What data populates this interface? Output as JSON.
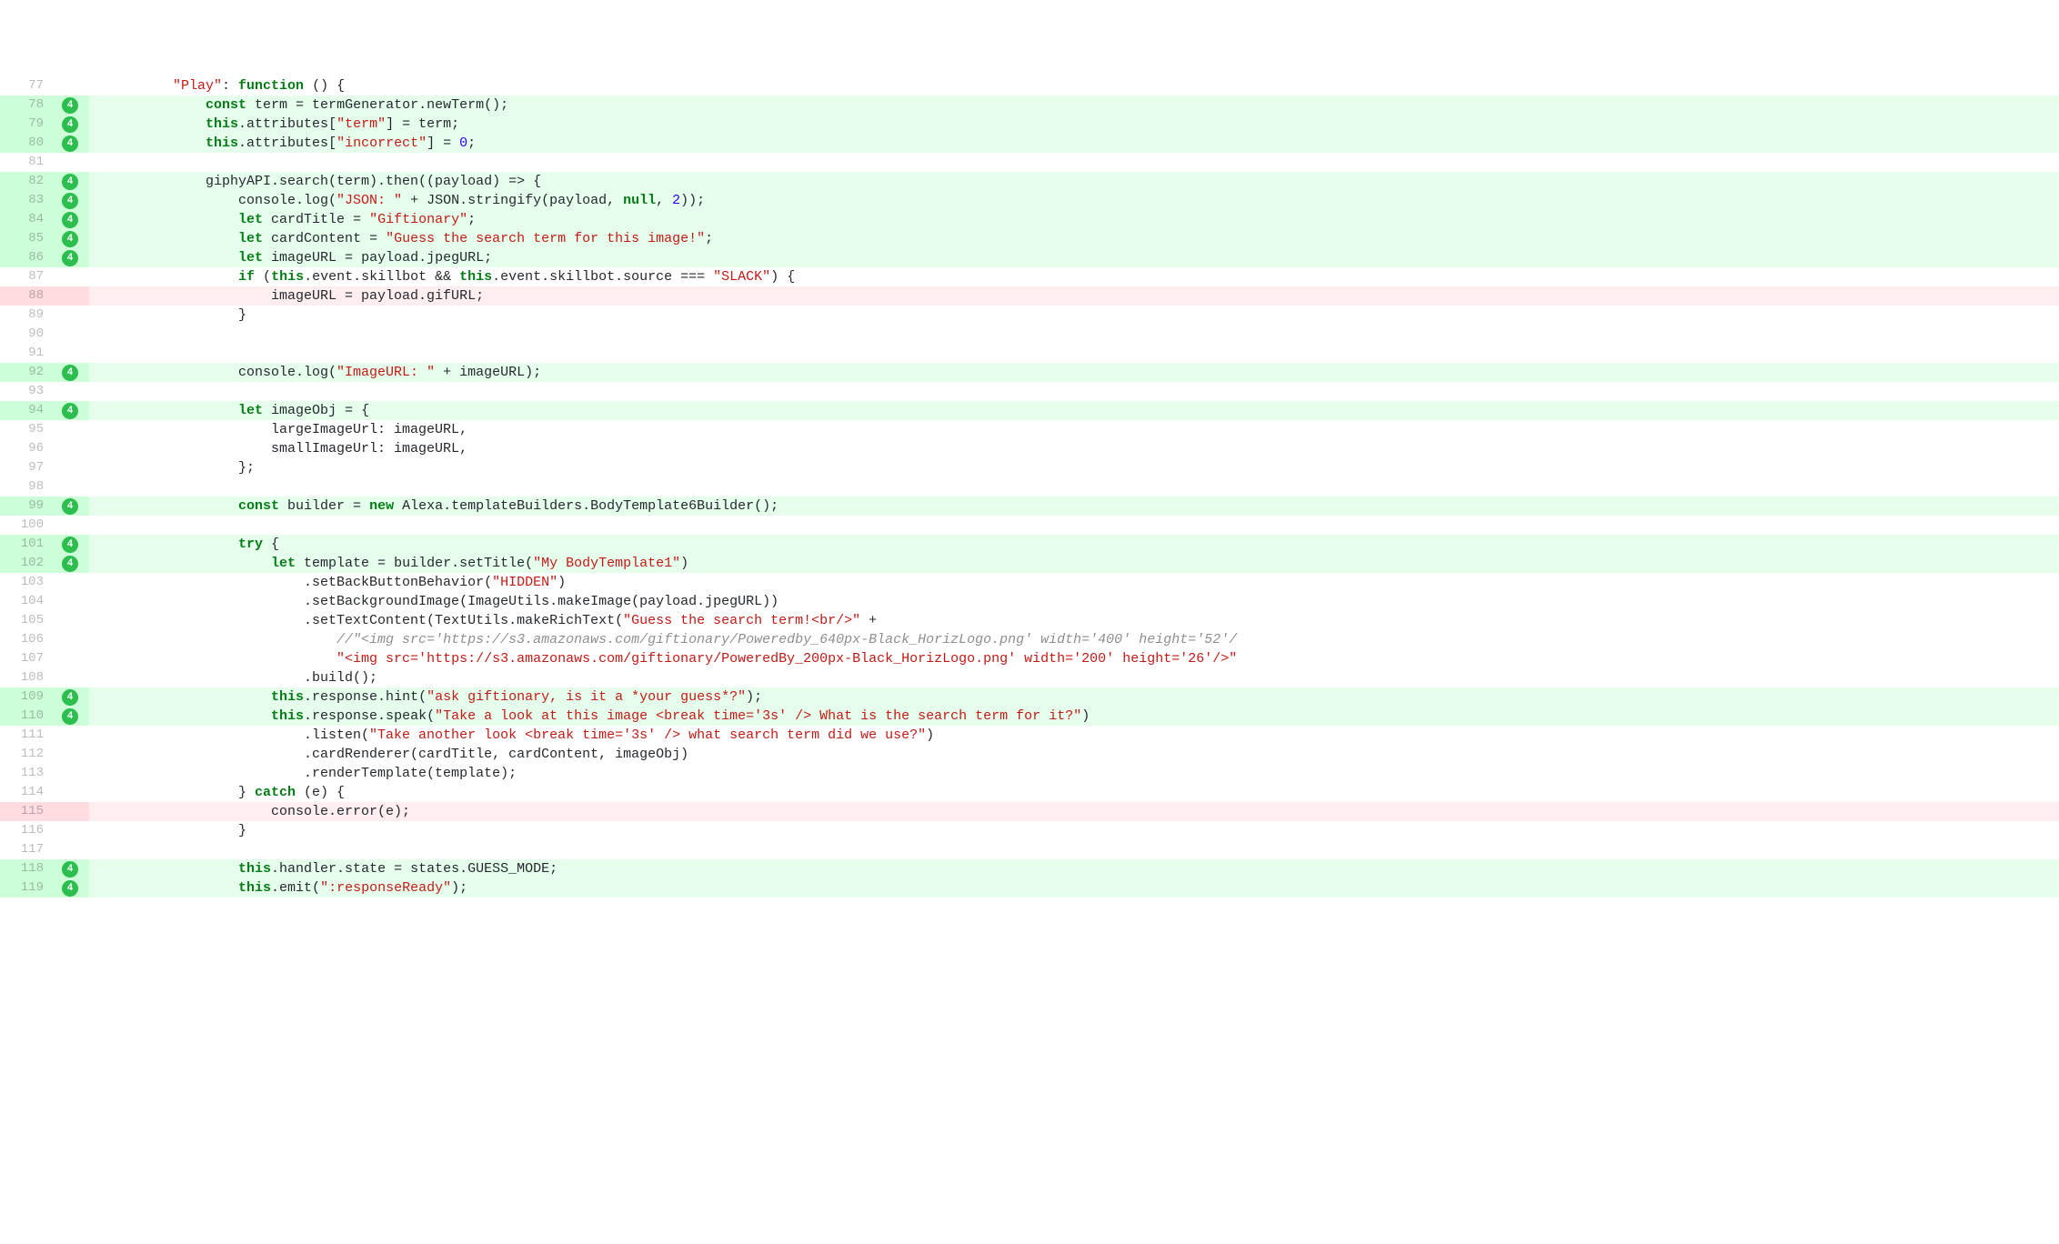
{
  "badge_label": "4",
  "lines": [
    {
      "num": 77,
      "kind": "ctx",
      "badge": false,
      "tokens": [
        {
          "c": "p",
          "t": "        "
        },
        {
          "c": "s",
          "t": "\"Play\""
        },
        {
          "c": "p",
          "t": ": "
        },
        {
          "c": "k",
          "t": "function"
        },
        {
          "c": "p",
          "t": " () {"
        }
      ]
    },
    {
      "num": 78,
      "kind": "add",
      "badge": true,
      "tokens": [
        {
          "c": "p",
          "t": "            "
        },
        {
          "c": "k",
          "t": "const"
        },
        {
          "c": "p",
          "t": " term = termGenerator.newTerm();"
        }
      ]
    },
    {
      "num": 79,
      "kind": "add",
      "badge": true,
      "tokens": [
        {
          "c": "p",
          "t": "            "
        },
        {
          "c": "kb",
          "t": "this"
        },
        {
          "c": "p",
          "t": ".attributes["
        },
        {
          "c": "s",
          "t": "\"term\""
        },
        {
          "c": "p",
          "t": "] = term;"
        }
      ]
    },
    {
      "num": 80,
      "kind": "add",
      "badge": true,
      "tokens": [
        {
          "c": "p",
          "t": "            "
        },
        {
          "c": "kb",
          "t": "this"
        },
        {
          "c": "p",
          "t": ".attributes["
        },
        {
          "c": "s",
          "t": "\"incorrect\""
        },
        {
          "c": "p",
          "t": "] = "
        },
        {
          "c": "n",
          "t": "0"
        },
        {
          "c": "p",
          "t": ";"
        }
      ]
    },
    {
      "num": 81,
      "kind": "ctx",
      "badge": false,
      "tokens": []
    },
    {
      "num": 82,
      "kind": "add",
      "badge": true,
      "tokens": [
        {
          "c": "p",
          "t": "            giphyAPI.search(term).then((payload) => {"
        }
      ]
    },
    {
      "num": 83,
      "kind": "add",
      "badge": true,
      "tokens": [
        {
          "c": "p",
          "t": "                console.log("
        },
        {
          "c": "s",
          "t": "\"JSON: \""
        },
        {
          "c": "p",
          "t": " + JSON.stringify(payload, "
        },
        {
          "c": "kb",
          "t": "null"
        },
        {
          "c": "p",
          "t": ", "
        },
        {
          "c": "n",
          "t": "2"
        },
        {
          "c": "p",
          "t": "));"
        }
      ]
    },
    {
      "num": 84,
      "kind": "add",
      "badge": true,
      "tokens": [
        {
          "c": "p",
          "t": "                "
        },
        {
          "c": "k",
          "t": "let"
        },
        {
          "c": "p",
          "t": " cardTitle = "
        },
        {
          "c": "s",
          "t": "\"Giftionary\""
        },
        {
          "c": "p",
          "t": ";"
        }
      ]
    },
    {
      "num": 85,
      "kind": "add",
      "badge": true,
      "tokens": [
        {
          "c": "p",
          "t": "                "
        },
        {
          "c": "k",
          "t": "let"
        },
        {
          "c": "p",
          "t": " cardContent = "
        },
        {
          "c": "s",
          "t": "\"Guess the search term for this image!\""
        },
        {
          "c": "p",
          "t": ";"
        }
      ]
    },
    {
      "num": 86,
      "kind": "add",
      "badge": true,
      "tokens": [
        {
          "c": "p",
          "t": "                "
        },
        {
          "c": "k",
          "t": "let"
        },
        {
          "c": "p",
          "t": " imageURL = payload.jpegURL;"
        }
      ]
    },
    {
      "num": 87,
      "kind": "ctx",
      "badge": false,
      "tokens": [
        {
          "c": "p",
          "t": "                "
        },
        {
          "c": "k",
          "t": "if"
        },
        {
          "c": "p",
          "t": " ("
        },
        {
          "c": "kb",
          "t": "this"
        },
        {
          "c": "p",
          "t": ".event.skillbot && "
        },
        {
          "c": "kb",
          "t": "this"
        },
        {
          "c": "p",
          "t": ".event.skillbot.source === "
        },
        {
          "c": "s",
          "t": "\"SLACK\""
        },
        {
          "c": "p",
          "t": ") {"
        }
      ]
    },
    {
      "num": 88,
      "kind": "del",
      "badge": false,
      "tokens": [
        {
          "c": "p",
          "t": "                    imageURL = payload.gifURL;"
        }
      ]
    },
    {
      "num": 89,
      "kind": "ctx",
      "badge": false,
      "tokens": [
        {
          "c": "p",
          "t": "                }"
        }
      ]
    },
    {
      "num": 90,
      "kind": "ctx",
      "badge": false,
      "tokens": []
    },
    {
      "num": 91,
      "kind": "ctx",
      "badge": false,
      "tokens": []
    },
    {
      "num": 92,
      "kind": "add",
      "badge": true,
      "tokens": [
        {
          "c": "p",
          "t": "                console.log("
        },
        {
          "c": "s",
          "t": "\"ImageURL: \""
        },
        {
          "c": "p",
          "t": " + imageURL);"
        }
      ]
    },
    {
      "num": 93,
      "kind": "ctx",
      "badge": false,
      "tokens": []
    },
    {
      "num": 94,
      "kind": "add",
      "badge": true,
      "tokens": [
        {
          "c": "p",
          "t": "                "
        },
        {
          "c": "k",
          "t": "let"
        },
        {
          "c": "p",
          "t": " imageObj = {"
        }
      ]
    },
    {
      "num": 95,
      "kind": "ctx",
      "badge": false,
      "tokens": [
        {
          "c": "p",
          "t": "                    largeImageUrl: imageURL,"
        }
      ]
    },
    {
      "num": 96,
      "kind": "ctx",
      "badge": false,
      "tokens": [
        {
          "c": "p",
          "t": "                    smallImageUrl: imageURL,"
        }
      ]
    },
    {
      "num": 97,
      "kind": "ctx",
      "badge": false,
      "tokens": [
        {
          "c": "p",
          "t": "                };"
        }
      ]
    },
    {
      "num": 98,
      "kind": "ctx",
      "badge": false,
      "tokens": []
    },
    {
      "num": 99,
      "kind": "add",
      "badge": true,
      "tokens": [
        {
          "c": "p",
          "t": "                "
        },
        {
          "c": "k",
          "t": "const"
        },
        {
          "c": "p",
          "t": " builder = "
        },
        {
          "c": "k",
          "t": "new"
        },
        {
          "c": "p",
          "t": " Alexa.templateBuilders.BodyTemplate6Builder();"
        }
      ]
    },
    {
      "num": 100,
      "kind": "ctx",
      "badge": false,
      "tokens": []
    },
    {
      "num": 101,
      "kind": "add",
      "badge": true,
      "tokens": [
        {
          "c": "p",
          "t": "                "
        },
        {
          "c": "k",
          "t": "try"
        },
        {
          "c": "p",
          "t": " {"
        }
      ]
    },
    {
      "num": 102,
      "kind": "add",
      "badge": true,
      "tokens": [
        {
          "c": "p",
          "t": "                    "
        },
        {
          "c": "k",
          "t": "let"
        },
        {
          "c": "p",
          "t": " template = builder.setTitle("
        },
        {
          "c": "s",
          "t": "\"My BodyTemplate1\""
        },
        {
          "c": "p",
          "t": ")"
        }
      ]
    },
    {
      "num": 103,
      "kind": "ctx",
      "badge": false,
      "tokens": [
        {
          "c": "p",
          "t": "                        .setBackButtonBehavior("
        },
        {
          "c": "s",
          "t": "\"HIDDEN\""
        },
        {
          "c": "p",
          "t": ")"
        }
      ]
    },
    {
      "num": 104,
      "kind": "ctx",
      "badge": false,
      "tokens": [
        {
          "c": "p",
          "t": "                        .setBackgroundImage(ImageUtils.makeImage(payload.jpegURL))"
        }
      ]
    },
    {
      "num": 105,
      "kind": "ctx",
      "badge": false,
      "tokens": [
        {
          "c": "p",
          "t": "                        .setTextContent(TextUtils.makeRichText("
        },
        {
          "c": "s",
          "t": "\"Guess the search term!<br/>\""
        },
        {
          "c": "p",
          "t": " +"
        }
      ]
    },
    {
      "num": 106,
      "kind": "ctx",
      "badge": false,
      "tokens": [
        {
          "c": "p",
          "t": "                            "
        },
        {
          "c": "cm",
          "t": "//\"<img src='https://s3.amazonaws.com/giftionary/Poweredby_640px-Black_HorizLogo.png' width='400' height='52'/"
        }
      ]
    },
    {
      "num": 107,
      "kind": "ctx",
      "badge": false,
      "tokens": [
        {
          "c": "p",
          "t": "                            "
        },
        {
          "c": "s",
          "t": "\"<img src='https://s3.amazonaws.com/giftionary/PoweredBy_200px-Black_HorizLogo.png' width='200' height='26'/>\""
        }
      ]
    },
    {
      "num": 108,
      "kind": "ctx",
      "badge": false,
      "tokens": [
        {
          "c": "p",
          "t": "                        .build();"
        }
      ]
    },
    {
      "num": 109,
      "kind": "add",
      "badge": true,
      "tokens": [
        {
          "c": "p",
          "t": "                    "
        },
        {
          "c": "kb",
          "t": "this"
        },
        {
          "c": "p",
          "t": ".response.hint("
        },
        {
          "c": "s",
          "t": "\"ask giftionary, is it a *your guess*?\""
        },
        {
          "c": "p",
          "t": ");"
        }
      ]
    },
    {
      "num": 110,
      "kind": "add",
      "badge": true,
      "tokens": [
        {
          "c": "p",
          "t": "                    "
        },
        {
          "c": "kb",
          "t": "this"
        },
        {
          "c": "p",
          "t": ".response.speak("
        },
        {
          "c": "s",
          "t": "\"Take a look at this image <break time='3s' /> What is the search term for it?\""
        },
        {
          "c": "p",
          "t": ")"
        }
      ]
    },
    {
      "num": 111,
      "kind": "ctx",
      "badge": false,
      "tokens": [
        {
          "c": "p",
          "t": "                        .listen("
        },
        {
          "c": "s",
          "t": "\"Take another look <break time='3s' /> what search term did we use?\""
        },
        {
          "c": "p",
          "t": ")"
        }
      ]
    },
    {
      "num": 112,
      "kind": "ctx",
      "badge": false,
      "tokens": [
        {
          "c": "p",
          "t": "                        .cardRenderer(cardTitle, cardContent, imageObj)"
        }
      ]
    },
    {
      "num": 113,
      "kind": "ctx",
      "badge": false,
      "tokens": [
        {
          "c": "p",
          "t": "                        .renderTemplate(template);"
        }
      ]
    },
    {
      "num": 114,
      "kind": "ctx",
      "badge": false,
      "tokens": [
        {
          "c": "p",
          "t": "                } "
        },
        {
          "c": "k",
          "t": "catch"
        },
        {
          "c": "p",
          "t": " (e) {"
        }
      ]
    },
    {
      "num": 115,
      "kind": "del",
      "badge": false,
      "tokens": [
        {
          "c": "p",
          "t": "                    console.error(e);"
        }
      ]
    },
    {
      "num": 116,
      "kind": "ctx",
      "badge": false,
      "tokens": [
        {
          "c": "p",
          "t": "                }"
        }
      ]
    },
    {
      "num": 117,
      "kind": "ctx",
      "badge": false,
      "tokens": []
    },
    {
      "num": 118,
      "kind": "add",
      "badge": true,
      "tokens": [
        {
          "c": "p",
          "t": "                "
        },
        {
          "c": "kb",
          "t": "this"
        },
        {
          "c": "p",
          "t": ".handler.state = states.GUESS_MODE;"
        }
      ]
    },
    {
      "num": 119,
      "kind": "add",
      "badge": true,
      "tokens": [
        {
          "c": "p",
          "t": "                "
        },
        {
          "c": "kb",
          "t": "this"
        },
        {
          "c": "p",
          "t": ".emit("
        },
        {
          "c": "s",
          "t": "\":responseReady\""
        },
        {
          "c": "p",
          "t": ");"
        }
      ]
    }
  ]
}
